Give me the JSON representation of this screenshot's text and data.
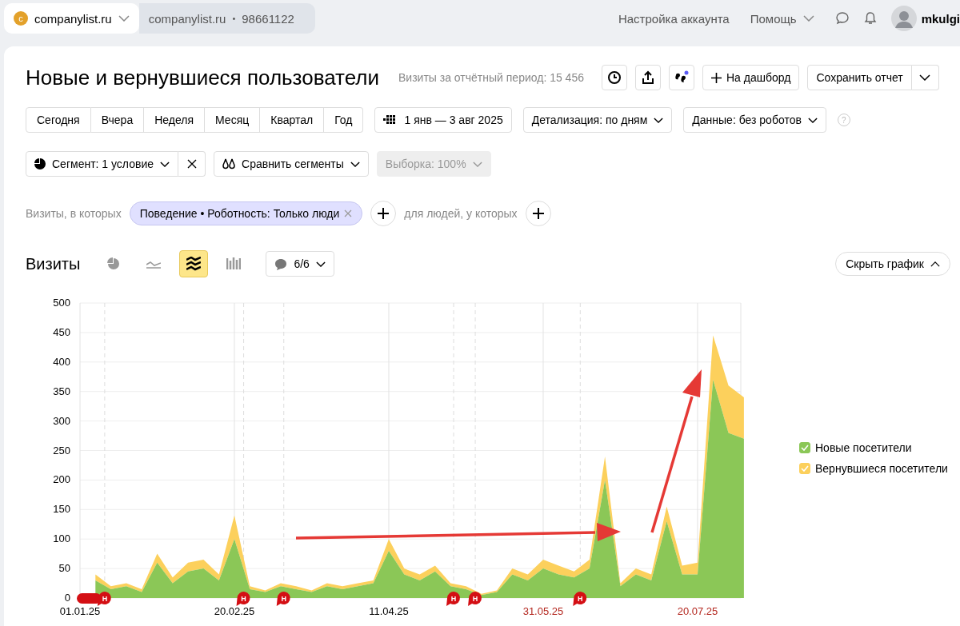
{
  "top_bar": {
    "site": {
      "letter": "c",
      "name": "companylist.ru"
    },
    "counter": {
      "name": "companylist.ru",
      "separator": "•",
      "id": "98661122"
    },
    "links": [
      "Настройка аккаунта",
      "Помощь"
    ],
    "user": "mkulgi"
  },
  "report": {
    "title": "Новые и вернувшиеся пользователи",
    "visits_label": "Визиты за отчётный период: 15 456",
    "add_dashboard": "На дашборд",
    "save": "Сохранить отчет"
  },
  "periods": [
    "Сегодня",
    "Вчера",
    "Неделя",
    "Месяц",
    "Квартал",
    "Год"
  ],
  "date_range": "1 янв — 3 авг 2025",
  "detail": "Детализация: по дням",
  "data_filter": "Данные: без роботов",
  "help": "?",
  "segment": {
    "label": "Сегмент: 1 условие",
    "compare": "Сравнить сегменты",
    "sample": "Выборка: 100%"
  },
  "filter": {
    "prefix": "Визиты, в которых",
    "chip": "Поведение • Роботность: Только люди",
    "suffix": "для людей, у которых"
  },
  "chart_header": {
    "title": "Визиты",
    "notes": "6/6",
    "hide": "Скрыть график"
  },
  "chart_types": [
    {
      "kind": "pie",
      "selected": false
    },
    {
      "kind": "line",
      "selected": false
    },
    {
      "kind": "area",
      "selected": true
    },
    {
      "kind": "bar",
      "selected": false
    }
  ],
  "chart_data": {
    "type": "area",
    "stacked": true,
    "grid": true,
    "ylim": [
      0,
      500
    ],
    "yticks": [
      0,
      50,
      100,
      150,
      200,
      250,
      300,
      350,
      400,
      450,
      500
    ],
    "categories": [
      "01.01.25",
      null,
      null,
      null,
      null,
      null,
      null,
      null,
      null,
      null,
      "20.02.25",
      null,
      null,
      null,
      null,
      null,
      null,
      null,
      null,
      null,
      "11.04.25",
      null,
      null,
      null,
      null,
      null,
      null,
      null,
      null,
      null,
      "31.05.25",
      null,
      null,
      null,
      null,
      null,
      null,
      null,
      null,
      null,
      "20.07.25",
      null,
      null,
      null
    ],
    "series": [
      {
        "name": "Новые посетители",
        "color": "#8bc757",
        "values": [
          null,
          30,
          15,
          20,
          10,
          60,
          25,
          45,
          50,
          30,
          100,
          15,
          10,
          20,
          15,
          10,
          20,
          15,
          20,
          25,
          80,
          40,
          30,
          45,
          20,
          15,
          5,
          10,
          40,
          30,
          50,
          40,
          35,
          50,
          200,
          20,
          40,
          30,
          130,
          40,
          40,
          370,
          280,
          270
        ]
      },
      {
        "name": "Вернувшиеся посетители",
        "color": "#fcd05c",
        "values": [
          null,
          10,
          5,
          5,
          5,
          15,
          10,
          15,
          15,
          10,
          40,
          5,
          3,
          5,
          5,
          3,
          5,
          5,
          5,
          5,
          20,
          10,
          10,
          10,
          5,
          5,
          2,
          3,
          10,
          10,
          15,
          15,
          10,
          15,
          40,
          5,
          10,
          10,
          25,
          15,
          20,
          75,
          80,
          70
        ]
      }
    ],
    "ylabel": null
  },
  "chart_markers": [
    {
      "text": "Н"
    },
    {
      "text": "Н"
    },
    {
      "text": "Н"
    },
    {
      "text": "Н"
    },
    {
      "text": "Н"
    },
    {
      "text": "Н"
    }
  ],
  "x_label_highlight": [
    false,
    false,
    false,
    true,
    true
  ],
  "legend": [
    {
      "checked": true
    },
    {
      "checked": true
    }
  ]
}
